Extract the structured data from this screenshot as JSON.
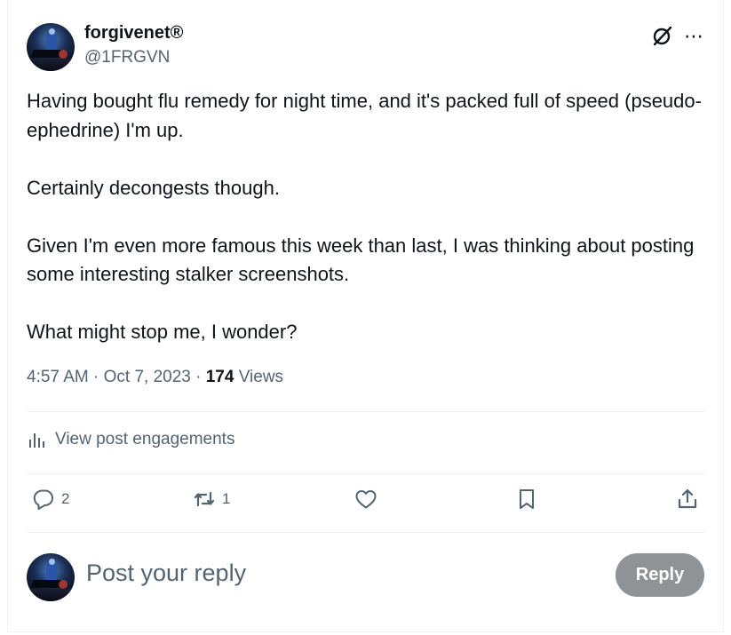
{
  "post": {
    "author_name": "forgivenet®",
    "author_handle": "@1FRGVN",
    "paragraphs": [
      "Having bought flu remedy for night time, and it's packed full of speed (pseudo-ephedrine) I'm up.",
      "Certainly decongests though.",
      "Given I'm even more famous this week than last, I was thinking about posting some interesting stalker screenshots.",
      "What might stop me, I wonder?"
    ],
    "time": "4:57 AM",
    "separator": "·",
    "date": "Oct 7, 2023",
    "views_count": "174",
    "views_label": "Views",
    "more_icon": "⋯"
  },
  "engagements_label": "View post engagements",
  "actions": {
    "reply_count": "2",
    "repost_count": "1"
  },
  "composer": {
    "placeholder": "Post your reply",
    "reply_label": "Reply"
  },
  "colors": {
    "text": "#0f1419",
    "secondary": "#536471",
    "divider": "#eff3f4",
    "reply_button_disabled": "#8f9396"
  }
}
